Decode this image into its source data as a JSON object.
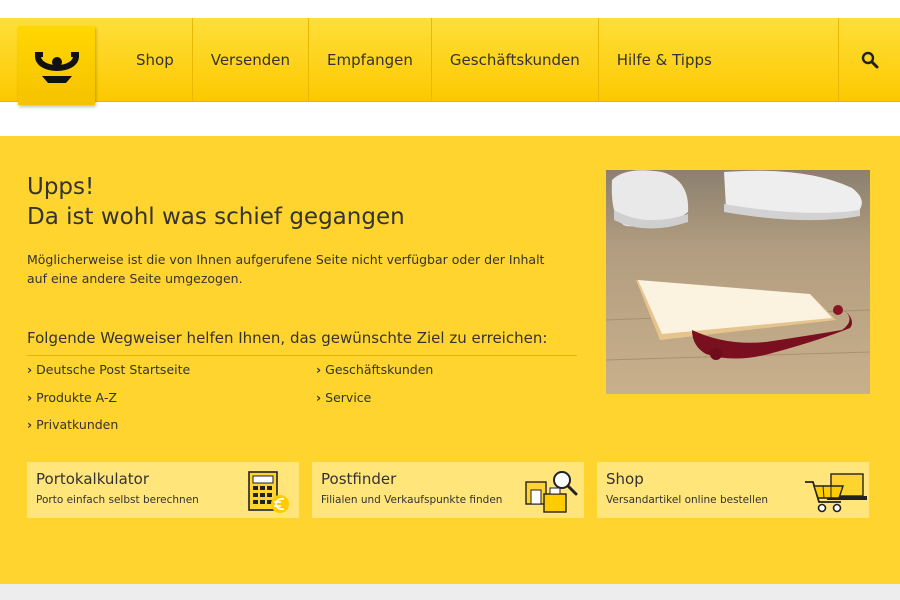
{
  "nav": {
    "items": [
      {
        "label": "Shop",
        "name": "nav-shop"
      },
      {
        "label": "Versenden",
        "name": "nav-versenden"
      },
      {
        "label": "Empfangen",
        "name": "nav-empfangen"
      },
      {
        "label": "Geschäftskunden",
        "name": "nav-geschaeftskunden"
      },
      {
        "label": "Hilfe & Tipps",
        "name": "nav-hilfe-tipps"
      }
    ],
    "search_icon": "search-icon",
    "logo_icon": "posthorn-logo-icon"
  },
  "error": {
    "title_line1": "Upps!",
    "title_line2": "Da ist wohl was schief gegangen",
    "description": "Möglicherweise ist die von Ihnen aufgerufene Seite nicht verfügbar oder der Inhalt auf  eine andere Seite umgezogen.",
    "image_icon": "toast-on-floor-image"
  },
  "guide": {
    "title": "Folgende Wegweiser helfen Ihnen, das gewünschte Ziel zu erreichen:",
    "links": [
      {
        "label": "Deutsche Post Startseite"
      },
      {
        "label": "Geschäftskunden"
      },
      {
        "label": "Produkte A-Z"
      },
      {
        "label": "Service"
      },
      {
        "label": "Privatkunden"
      }
    ],
    "chevron": "›"
  },
  "teasers": [
    {
      "title": "Portokalkulator",
      "subtitle": "Porto einfach selbst berechnen",
      "icon": "calculator-icon"
    },
    {
      "title": "Postfinder",
      "subtitle": "Filialen und Verkaufspunkte finden",
      "icon": "postfinder-icon"
    },
    {
      "title": "Shop",
      "subtitle": "Versandartikel online bestellen",
      "icon": "shopping-cart-icon"
    }
  ],
  "colors": {
    "brand_yellow": "#ffcc00",
    "panel_yellow": "#ffd42f",
    "teaser_yellow": "#ffe57a",
    "text": "#333333"
  }
}
